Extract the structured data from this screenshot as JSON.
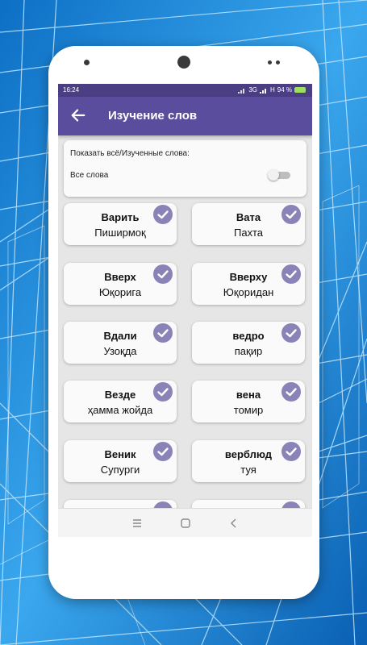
{
  "status_bar": {
    "time": "16:24",
    "network_1": "3G",
    "network_2": "H",
    "battery": "94 %"
  },
  "app_bar": {
    "title": "Изучение слов",
    "back_icon": "arrow-left-icon"
  },
  "filter": {
    "label": "Показать всё/Изученные слова:",
    "value": "Все слова",
    "switch_on": false
  },
  "words": [
    {
      "ru": "Варить",
      "uz": "Пишир­моқ",
      "learned": true
    },
    {
      "ru": "Вата",
      "uz": "Пахта",
      "learned": true
    },
    {
      "ru": "Вверх",
      "uz": "Юқорига",
      "learned": true
    },
    {
      "ru": "Вверху",
      "uz": "Юқоридан",
      "learned": true
    },
    {
      "ru": "Вдали",
      "uz": "Узоқда",
      "learned": true
    },
    {
      "ru": "ведро",
      "uz": "пақир",
      "learned": true
    },
    {
      "ru": "Везде",
      "uz": "ҳамма жойда",
      "learned": true
    },
    {
      "ru": "вена",
      "uz": "томир",
      "learned": true
    },
    {
      "ru": "Веник",
      "uz": "Супурги",
      "learned": true
    },
    {
      "ru": "верблюд",
      "uz": "туя",
      "learned": true
    }
  ],
  "colors": {
    "status_bar": "#4b3e82",
    "app_bar": "#5a4d9e",
    "check": "#8a83b7",
    "background": "#1f8fd8"
  },
  "nav_icons": [
    "menu-icon",
    "home-square-icon",
    "back-chevron-icon"
  ]
}
